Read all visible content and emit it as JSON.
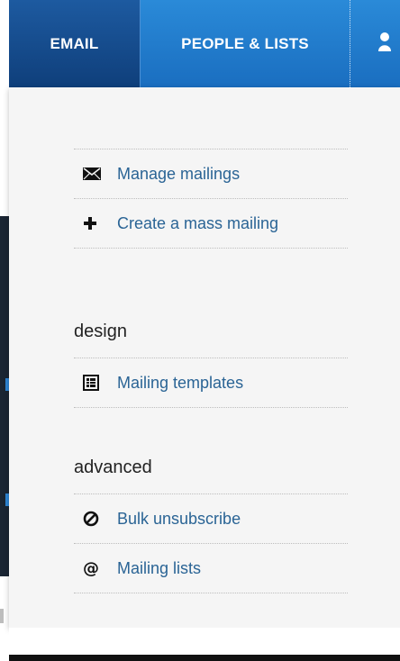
{
  "nav": {
    "tabs": [
      {
        "label": "EMAIL"
      },
      {
        "label": "PEOPLE & LISTS"
      }
    ]
  },
  "menu": {
    "mailing": {
      "items": [
        {
          "label": "Manage mailings",
          "icon": "envelope-icon"
        },
        {
          "label": "Create a mass mailing",
          "icon": "plus-icon"
        }
      ]
    },
    "design": {
      "heading": "design",
      "items": [
        {
          "label": "Mailing templates",
          "icon": "template-icon"
        }
      ]
    },
    "advanced": {
      "heading": "advanced",
      "items": [
        {
          "label": "Bulk unsubscribe",
          "icon": "no-entry-icon"
        },
        {
          "label": "Mailing lists",
          "icon": "at-icon"
        }
      ]
    }
  },
  "colors": {
    "nav_active": "#1d5aa0",
    "nav_inactive": "#2a8ad8",
    "link": "#2a6495",
    "panel_bg": "#f5f5f5"
  }
}
